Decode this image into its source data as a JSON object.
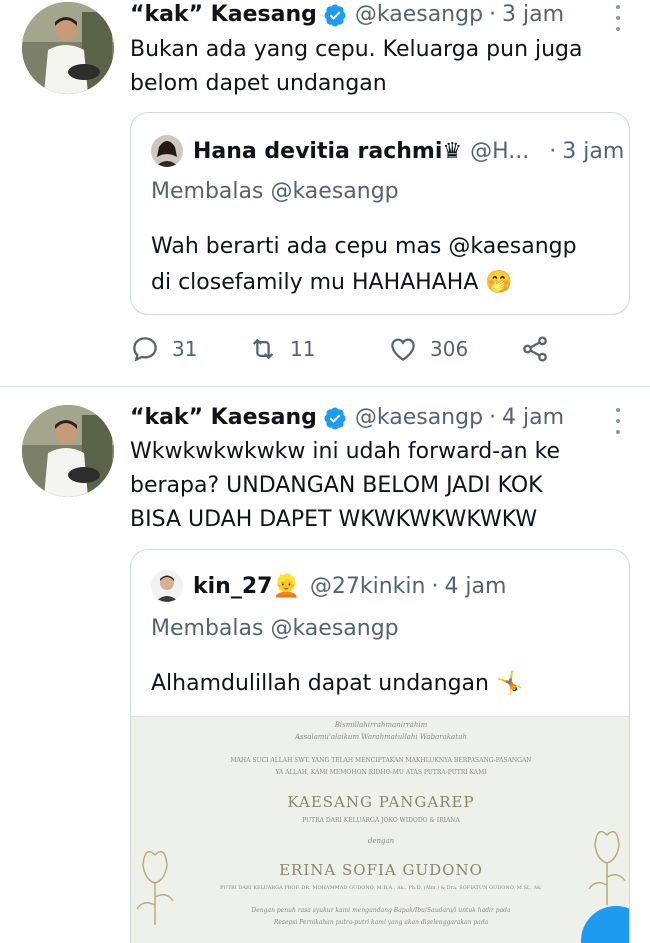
{
  "tweets": [
    {
      "author_name": "“kak” Kaesang",
      "handle": "@kaesangp",
      "time": "3 jam",
      "text_lines": [
        "Bukan ada yang cepu. Keluarga pun juga",
        "belom dapet undangan"
      ],
      "quote": {
        "author_name": "Hana devitia rachmi♛",
        "handle": "@H...",
        "time": "3 jam",
        "reply_to": "Membalas @kaesangp",
        "text_lines": [
          "Wah berarti ada cepu mas @kaesangp",
          "di closefamily mu HAHAHAHA 🤭"
        ]
      },
      "actions": {
        "replies": "31",
        "retweets": "11",
        "likes": "306"
      }
    },
    {
      "author_name": "“kak” Kaesang",
      "handle": "@kaesangp",
      "time": "4 jam",
      "text_lines": [
        "Wkwkwkwkwkw ini udah forward-an ke",
        "berapa? UNDANGAN BELOM JADI KOK",
        "BISA UDAH DAPET WKWKWKWKWKW"
      ],
      "quote": {
        "author_name": "kin_27👱",
        "handle": "@27kinkin",
        "time": "4 jam",
        "reply_to": "Membalas @kaesangp",
        "text_lines": [
          "Alhamdulillah dapat undangan 🤸"
        ],
        "invitation": {
          "line1": "Bismillahirrahmanirrahim",
          "line2": "Assalamu'alaikum Warahmatullahi Wabarakatuh",
          "line3": "MAHA SUCI ALLAH SWT. YANG TELAH MENCIPTAKAN MAKHLUKNYA BERPASANG-PASANGAN",
          "line4": "YA ALLAH, KAMI MEMOHON RIDHO-MU ATAS PUTRA-PUTRI KAMI",
          "groom": "KAESANG PANGAREP",
          "groom_parents": "PUTRA DARI KELUARGA JOKO WIDODO & IRIANA",
          "with": "dengan",
          "bride": "ERINA SOFIA GUDONO",
          "bride_parents": "PUTRI DARI KELUARGA PROF. DR. MOHAMMAD GUDONO, M.B.A., Ak., Ph.D. (Alm.) & Dra. SOFIATUN GUDONO, M.SI., Ak.",
          "line5": "Dengan penuh rasa syukur kami mengundang Bapak/Ibu/Saudara/i untuk hadir pada",
          "line6": "Resepsi Pernikahan putra-putri kami yang akan diselenggarakan pada"
        }
      }
    }
  ],
  "colors": {
    "accent": "#1d9bf0",
    "muted": "#536471",
    "border": "#cfd9de"
  }
}
